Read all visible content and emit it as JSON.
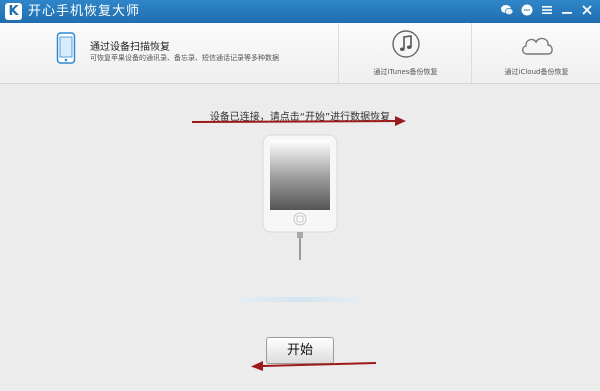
{
  "window": {
    "title": "开心手机恢复大师",
    "logo_letter": "K"
  },
  "titlebar_icons": [
    "wechat-icon",
    "message-icon",
    "menu-icon",
    "minimize-icon",
    "close-icon"
  ],
  "tabs": [
    {
      "title": "通过设备扫描恢复",
      "subtitle": "可恢复苹果设备的通讯录、备忘录、短信通话记录等多种数据",
      "icon": "phone-icon",
      "active": true
    },
    {
      "label": "通过iTunes备份恢复",
      "icon": "music-note-icon",
      "active": false
    },
    {
      "label": "通过iCloud备份恢复",
      "icon": "cloud-icon",
      "active": false
    }
  ],
  "main": {
    "instruction": "设备已连接，请点击“开始”进行数据恢复",
    "start_button": "开始"
  },
  "colors": {
    "titlebar": "#1f6fb0",
    "accent_arrow": "#9b1b1b",
    "background": "#ececec"
  }
}
